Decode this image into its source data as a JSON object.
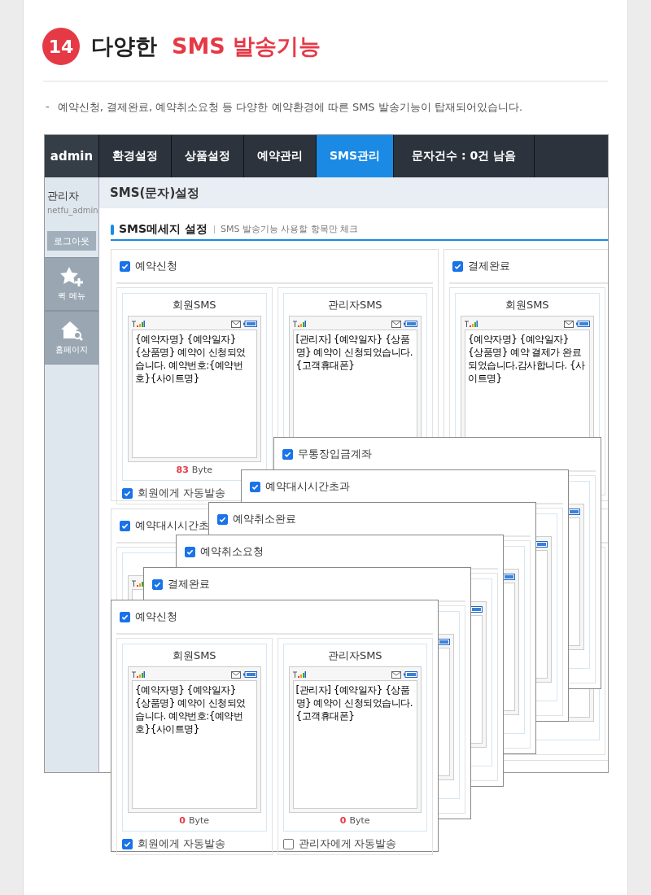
{
  "section": {
    "number": "14",
    "title": "다양한",
    "highlight": "SMS 발송기능",
    "bullet": "-",
    "description": "예약신청, 결제완료, 예약취소요청 등 다양한 예약환경에 따른 SMS 발송기능이 탑재되어있습니다."
  },
  "admin": {
    "logo": "admin",
    "tabs": [
      {
        "label": "환경설정",
        "selected": false
      },
      {
        "label": "상품설정",
        "selected": false
      },
      {
        "label": "예약관리",
        "selected": false
      },
      {
        "label": "SMS관리",
        "selected": true
      },
      {
        "label": "문자건수 : 0건 남음",
        "selected": false
      }
    ],
    "sidebar": {
      "role": "관리자",
      "user": "netfu_admin",
      "logout": "로그아웃",
      "quick_links": [
        {
          "kind": "star",
          "label": "퀵 메뉴"
        },
        {
          "kind": "home",
          "label": "홈페이지"
        }
      ]
    },
    "page_title": "SMS(문자)설정",
    "section_title": "SMS메세지 설정",
    "section_hint": "SMS 발송기능 사용할 항목만 체크",
    "cards": [
      {
        "title": "예약신청",
        "checked": true,
        "panels": [
          {
            "label": "회원SMS",
            "message": "{예약자명} {예약일자} {상품명} 예약이 신청되었습니다. 예약번호:{예약번호}{사이트명}",
            "bytes": "83",
            "unit": "Byte",
            "auto_send": {
              "label": "회원에게 자동발송",
              "checked": true
            }
          },
          {
            "label": "관리자SMS",
            "message": "[관리자] {예약일자} {상품명} 예약이 신청되었습니다. {고객휴대폰}"
          }
        ]
      },
      {
        "title": "결제완료",
        "checked": true,
        "panels": [
          {
            "label": "회원SMS",
            "message": "{예약자명} {예약일자} {상품명} 예약 결제가 완료 되었습니다.감사합니다. {사이트명}"
          }
        ]
      },
      {
        "title": "예약대시시간초",
        "checked": true
      }
    ],
    "overlay_cards": [
      {
        "title": "무통장입금계좌",
        "checked": true
      },
      {
        "title": "예약대시시간초과",
        "checked": true
      },
      {
        "title": "예약취소완료",
        "checked": true
      },
      {
        "title": "예약취소요청",
        "checked": true
      },
      {
        "title": "결제완료",
        "checked": true
      },
      {
        "title": "예약신청",
        "checked": true,
        "panels": [
          {
            "label": "회원SMS",
            "message": "{예약자명} {예약일자} {상품명} 예약이 신청되었습니다. 예약번호:{예약번호}{사이트명}",
            "bytes": "0",
            "unit": "Byte",
            "auto_send": {
              "label": "회원에게 자동발송",
              "checked": true
            }
          },
          {
            "label": "관리자SMS",
            "message": "[관리자] {예약일자} {상품명} 예약이 신청되었습니다. {고객휴대폰}",
            "bytes": "0",
            "unit": "Byte",
            "auto_send": {
              "label": "관리자에게 자동발송",
              "checked": false
            }
          }
        ]
      }
    ]
  }
}
